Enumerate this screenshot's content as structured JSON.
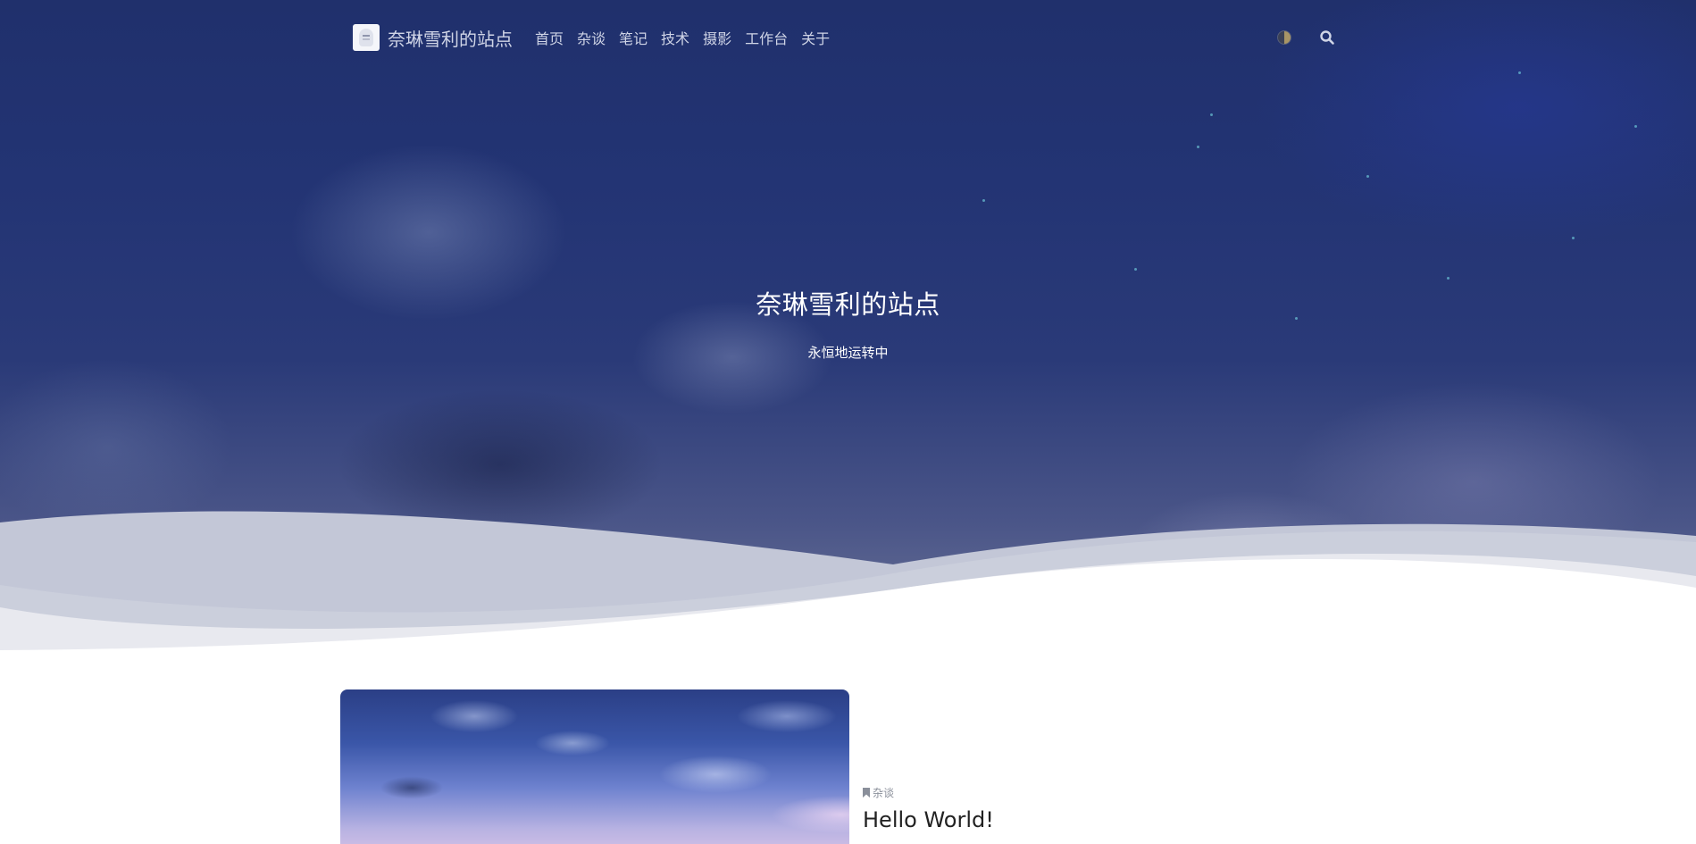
{
  "site": {
    "name": "奈琳雪利的站点"
  },
  "nav": {
    "items": [
      {
        "label": "首页"
      },
      {
        "label": "杂谈"
      },
      {
        "label": "笔记"
      },
      {
        "label": "技术"
      },
      {
        "label": "摄影"
      },
      {
        "label": "工作台"
      },
      {
        "label": "关于"
      }
    ],
    "theme_toggle_icon": "half-moon-icon",
    "search_icon": "search-icon"
  },
  "hero": {
    "title": "奈琳雪利的站点",
    "subtitle": "永恒地运转中"
  },
  "posts": [
    {
      "category": "杂谈",
      "category_icon": "bookmark-icon",
      "title": "Hello World!"
    }
  ],
  "colors": {
    "hero_sky": "#233474",
    "nav_text": "#cfd4e6",
    "title_text": "#ffffff",
    "post_title": "#222222",
    "meta_text": "#8a8f9a"
  }
}
